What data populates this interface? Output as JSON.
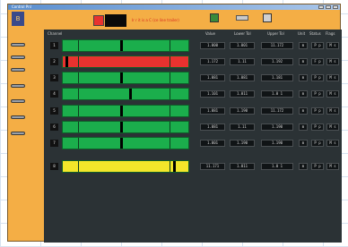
{
  "window": {
    "title": "Control Pnl"
  },
  "toolbar": {
    "logo": "B",
    "status_text": "Ir r it is a C (ce line trailer)"
  },
  "header": {
    "name": "Channel",
    "col1": "Value",
    "col2": "Lower Tol",
    "col3": "Upper Tol",
    "col4": "Unit",
    "col5": "Status",
    "col6": "Flags"
  },
  "colors": {
    "ok": "#1bae4c",
    "alarm": "#e8322f",
    "warn": "#f2e62a"
  },
  "rows": [
    {
      "label": "1",
      "state": "ok",
      "marker": 0.46,
      "value": "1.000",
      "lower": "1.001",
      "upper": "11.172",
      "unit": "m",
      "status": "P p",
      "flag": "M s"
    },
    {
      "label": "2",
      "state": "alarm",
      "marker": 0.02,
      "value": "1.172",
      "lower": "1.11",
      "upper": "1.192",
      "unit": "m",
      "status": "F p",
      "flag": "M s"
    },
    {
      "label": "3",
      "state": "ok",
      "marker": 0.46,
      "value": "1.081",
      "lower": "1.081",
      "upper": "1.181",
      "unit": "m",
      "status": "P p",
      "flag": "M s"
    },
    {
      "label": "4",
      "state": "ok",
      "marker": 0.53,
      "value": "1.101",
      "lower": "1.011",
      "upper": "1.0 1",
      "unit": "m",
      "status": "P p",
      "flag": "M s"
    },
    {
      "label": "5",
      "state": "ok",
      "marker": 0.46,
      "value": "1.081",
      "lower": "1.190",
      "upper": "11.172",
      "unit": "m",
      "status": "P p",
      "flag": "M s"
    },
    {
      "label": "6",
      "state": "ok",
      "marker": 0.46,
      "value": "1.081",
      "lower": "1.11",
      "upper": "1.190",
      "unit": "m",
      "status": "P p",
      "flag": "M s"
    },
    {
      "label": "7",
      "state": "ok",
      "marker": 0.46,
      "value": "1.001",
      "lower": "1.190",
      "upper": "1.190",
      "unit": "m",
      "status": "P p",
      "flag": "M s"
    },
    {
      "label": "8",
      "state": "warn",
      "marker": 0.88,
      "value": "11.171",
      "lower": "1.011",
      "upper": "1.0 1",
      "unit": "m",
      "status": "P p",
      "flag": "M s"
    }
  ]
}
